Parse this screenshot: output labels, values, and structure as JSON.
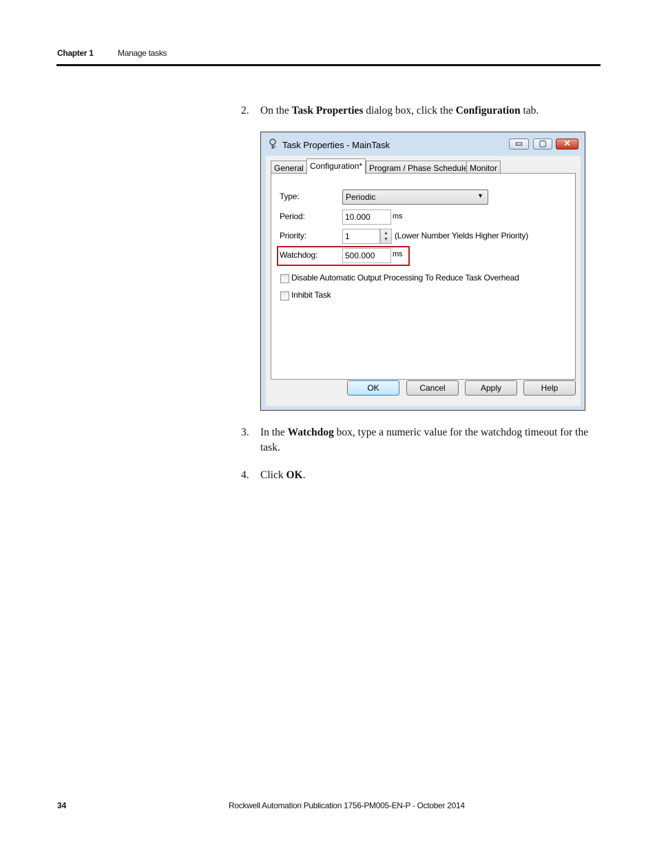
{
  "header": {
    "chapter": "Chapter 1",
    "section": "Manage tasks"
  },
  "steps": [
    {
      "number": "2.",
      "parts": [
        "On the ",
        "Task Properties",
        " dialog box, click the ",
        "Configuration",
        " tab."
      ]
    },
    {
      "number": "3.",
      "parts": [
        "In the ",
        "Watchdog",
        " box, type a numeric value for the watchdog timeout for the task."
      ]
    },
    {
      "number": "4.",
      "parts": [
        "Click ",
        "OK",
        "."
      ]
    }
  ],
  "dialog": {
    "title": "Task Properties - MainTask",
    "window_buttons": {
      "minimize": "▭",
      "maximize": "▢",
      "close": "✕"
    },
    "tabs": [
      "General",
      "Configuration*",
      "Program / Phase Schedule",
      "Monitor"
    ],
    "active_tab": "Configuration*",
    "type_label": "Type:",
    "type_value": "Periodic",
    "period_label": "Period:",
    "period_value": "10.000",
    "period_unit": "ms",
    "priority_label": "Priority:",
    "priority_value": "1",
    "priority_hint": "(Lower Number Yields Higher Priority)",
    "watchdog_label": "Watchdog:",
    "watchdog_value": "500.000",
    "watchdog_unit": "ms",
    "checkbox_disable_output": "Disable Automatic Output Processing To Reduce Task Overhead",
    "checkbox_inhibit": "Inhibit Task",
    "buttons": {
      "ok": "OK",
      "cancel": "Cancel",
      "apply": "Apply",
      "help": "Help"
    },
    "highlight_color": "#c0151b"
  },
  "footer": {
    "page": "34",
    "publication": "Rockwell Automation Publication 1756-PM005-EN-P - October 2014"
  }
}
